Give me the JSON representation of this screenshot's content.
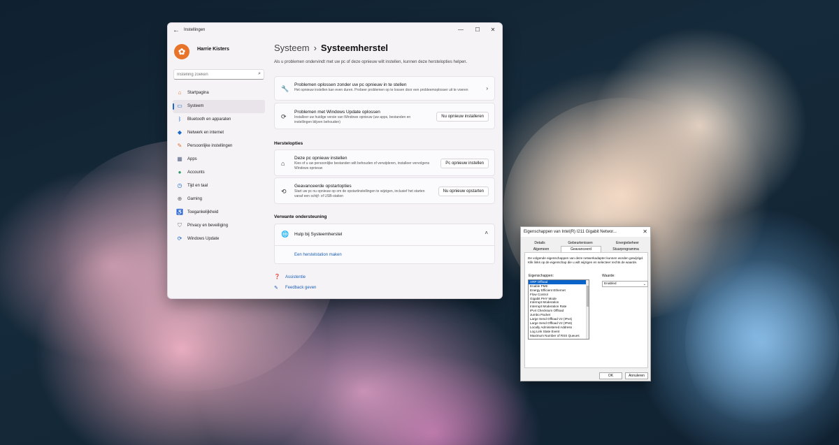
{
  "settings_window": {
    "title": "Instellingen",
    "controls": {
      "minimize": "—",
      "maximize": "☐",
      "close": "✕"
    },
    "profile": {
      "name": "Harrie Kisters"
    },
    "search": {
      "placeholder": "Instelling zoeken"
    },
    "nav": [
      {
        "label": "Startpagina",
        "icon": "home-icon",
        "color": "#e8742a",
        "active": false
      },
      {
        "label": "Systeem",
        "icon": "monitor-icon",
        "color": "#1a6ac8",
        "active": true
      },
      {
        "label": "Bluetooth en apparaten",
        "icon": "bluetooth-icon",
        "color": "#1a6ac8",
        "active": false
      },
      {
        "label": "Netwerk en internet",
        "icon": "wifi-icon",
        "color": "#1a6ac8",
        "active": false
      },
      {
        "label": "Persoonlijke instellingen",
        "icon": "brush-icon",
        "color": "#d87030",
        "active": false
      },
      {
        "label": "Apps",
        "icon": "apps-icon",
        "color": "#5a6a8a",
        "active": false
      },
      {
        "label": "Accounts",
        "icon": "person-icon",
        "color": "#2a9a6a",
        "active": false
      },
      {
        "label": "Tijd en taal",
        "icon": "globe-clock-icon",
        "color": "#1a6ac8",
        "active": false
      },
      {
        "label": "Gaming",
        "icon": "controller-icon",
        "color": "#666",
        "active": false
      },
      {
        "label": "Toegankelijkheid",
        "icon": "accessibility-icon",
        "color": "#1a6ac8",
        "active": false
      },
      {
        "label": "Privacy en beveiliging",
        "icon": "shield-icon",
        "color": "#777",
        "active": false
      },
      {
        "label": "Windows Update",
        "icon": "update-icon",
        "color": "#1a6ac8",
        "active": false
      }
    ],
    "breadcrumb": {
      "parent": "Systeem",
      "separator": "›",
      "current": "Systeemherstel"
    },
    "intro": "Als u problemen ondervindt met uw pc of deze opnieuw wilt instellen, kunnen deze herstelopties helpen.",
    "cards_top": [
      {
        "title": "Problemen oplossen zonder uw pc opnieuw in te stellen",
        "desc": "Het opnieuw instellen kan even duren. Probeer problemen op te lossen door een probleemoplosser uit te voeren",
        "icon": "wrench-icon"
      },
      {
        "title": "Problemen met Windows Update oplossen",
        "desc": "Installeer uw huidige versie van Windows opnieuw (uw apps, bestanden en instellingen blijven behouden)",
        "button": "Nu opnieuw installeren",
        "icon": "sync-icon"
      }
    ],
    "section_recovery": "Herstelopties",
    "cards_recovery": [
      {
        "title": "Deze pc opnieuw instellen",
        "desc": "Kies of u uw persoonlijke bestanden wilt behouden of verwijderen, installeer vervolgens Windows opnieuw",
        "button": "Pc opnieuw instellen",
        "icon": "reset-pc-icon"
      },
      {
        "title": "Geavanceerde opstartopties",
        "desc": "Start uw pc nu opnieuw op om de opstartinstellingen te wijzigen, inclusief het starten vanaf een schijf- of USB-station",
        "button": "Nu opnieuw opstarten",
        "icon": "startup-icon"
      }
    ],
    "section_related": "Verwante ondersteuning",
    "related": {
      "title": "Hulp bij Systeemherstel",
      "link": "Een herstelstation maken"
    },
    "footer": {
      "help": "Assistentie",
      "feedback": "Feedback geven"
    }
  },
  "dialog": {
    "title": "Eigenschappen van Intel(R) I211 Gigabit Networ...",
    "close": "✕",
    "tabs_row1": [
      "Details",
      "Gebeurtenissen",
      "Energiebeheer"
    ],
    "tabs_row2": [
      "Algemeen",
      "Geavanceerd",
      "Stuurprogramma"
    ],
    "description": "De volgende eigenschappen van deze netwerkadapter kunnen worden gewijzigd. Klik links op de eigenschap die u wilt wijzigen en selecteer rechts de waarde.",
    "properties_label": "Eigenschappen:",
    "value_label": "Waarde:",
    "properties": [
      "ARP Offload",
      "Enable PME",
      "Energy Efficient Ethernet",
      "Flow Control",
      "Gigabit PHY Mode",
      "Interrupt Moderation",
      "Interrupt Moderation Rate",
      "IPv4 Checksum Offload",
      "Jumbo Packet",
      "Large Send Offload V2 (IPv4)",
      "Large Send Offload V2 (IPv6)",
      "Locally Administered Address",
      "Log Link State Event",
      "Maximum Number of RSS Queues"
    ],
    "selected_value": "Enabled",
    "ok": "OK",
    "cancel": "Annuleren"
  }
}
